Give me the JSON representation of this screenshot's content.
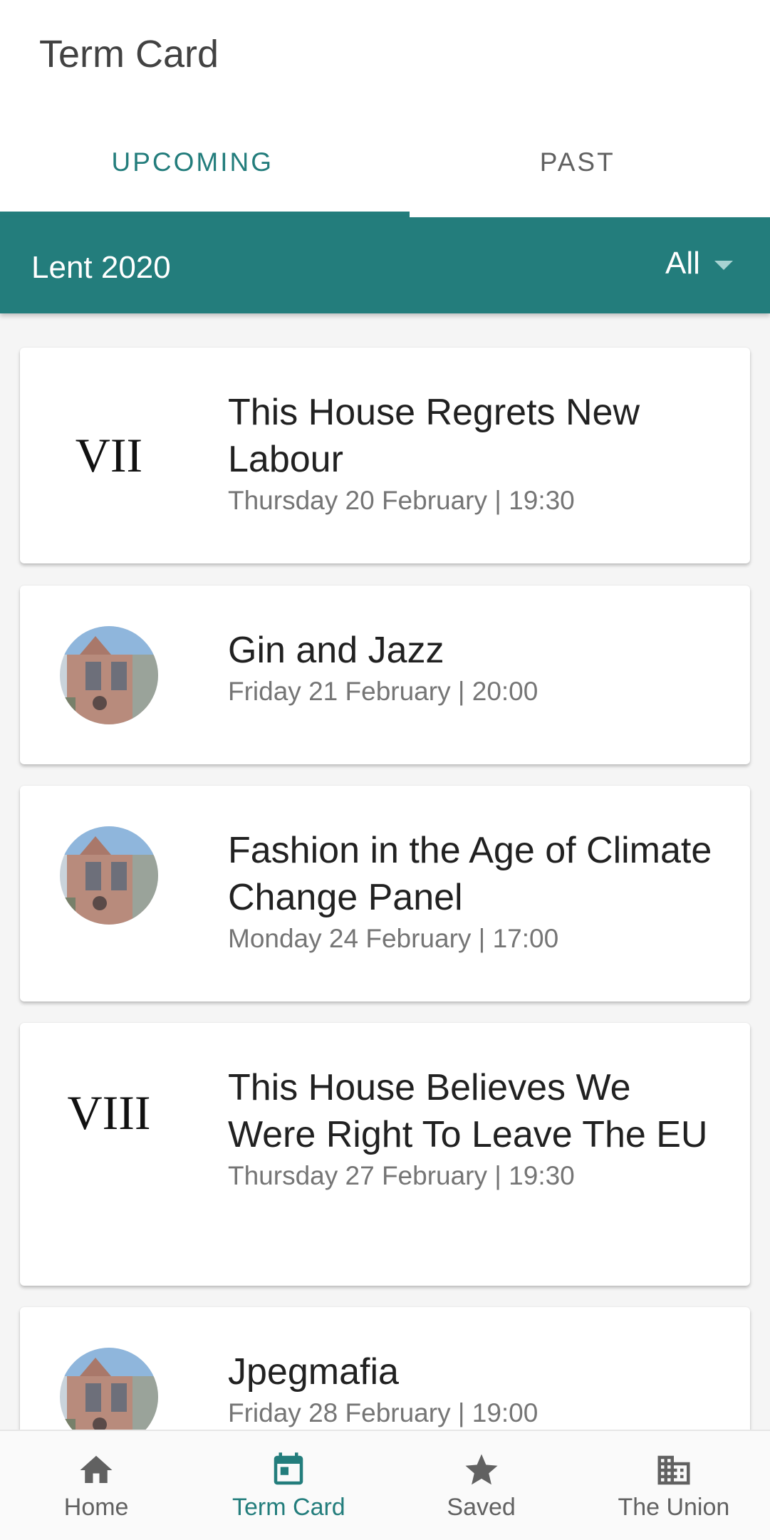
{
  "header": {
    "title": "Term Card"
  },
  "tabs": [
    {
      "label": "UPCOMING",
      "active": true
    },
    {
      "label": "PAST",
      "active": false
    }
  ],
  "filter_bar": {
    "term": "Lent 2020",
    "filter_value": "All"
  },
  "events": [
    {
      "badge": "VII",
      "thumb": "numeral",
      "title": "This House Regrets New Labour",
      "datetime": "Thursday 20 February | 19:30"
    },
    {
      "badge": "",
      "thumb": "building-photo",
      "title": "Gin and Jazz",
      "datetime": "Friday 21 February | 20:00"
    },
    {
      "badge": "",
      "thumb": "building-photo",
      "title": "Fashion in the Age of Climate Change Panel",
      "datetime": "Monday 24 February | 17:00"
    },
    {
      "badge": "VIII",
      "thumb": "numeral",
      "title": "This House Believes We Were Right To Leave The EU",
      "datetime": "Thursday 27 February | 19:30"
    },
    {
      "badge": "",
      "thumb": "building-photo",
      "title": "Jpegmafia",
      "datetime": "Friday 28 February | 19:00"
    }
  ],
  "bottom_nav": [
    {
      "label": "Home",
      "icon": "home-icon",
      "active": false
    },
    {
      "label": "Term Card",
      "icon": "calendar-icon",
      "active": true
    },
    {
      "label": "Saved",
      "icon": "star-icon",
      "active": false
    },
    {
      "label": "The Union",
      "icon": "building-icon",
      "active": false
    }
  ],
  "colors": {
    "accent": "#237d7c",
    "background": "#f5f5f5",
    "card": "#ffffff"
  }
}
